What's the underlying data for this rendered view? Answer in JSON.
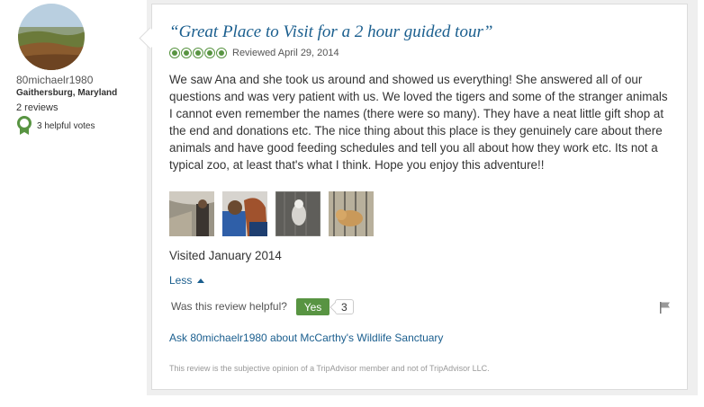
{
  "reviewer": {
    "username": "80michaelr1980",
    "location": "Gaithersburg, Maryland",
    "reviews_count": "2 reviews",
    "helpful_votes": "3 helpful votes"
  },
  "review": {
    "title": "“Great Place to Visit for a 2 hour guided tour”",
    "rating": 5,
    "rating_max": 5,
    "reviewed_date": "Reviewed April 29, 2014",
    "body": "We saw Ana and she took us around and showed us everything! She answered all of our questions and was very patient with us. We loved the tigers and some of the stranger animals I cannot even remember the names (there were so many). They have a neat little gift shop at the end and donations etc. The nice thing about this place is they genuinely care about there animals and have good feeding schedules and tell you all about how they work etc. Its not a typical zoo, at least that's what I think. Hope you enjoy this adventure!!",
    "visited": "Visited January 2014",
    "less_label": "Less",
    "photo_count": 4
  },
  "actions": {
    "helpful_question": "Was this review helpful?",
    "yes_label": "Yes",
    "yes_count": "3",
    "ask_label": "Ask 80michaelr1980 about McCarthy's Wildlife Sanctuary"
  },
  "disclaimer": "This review is the subjective opinion of a TripAdvisor member and not of TripAdvisor LLC.",
  "colors": {
    "link": "#1a5e8e",
    "rating_green": "#589442",
    "button_green": "#589442"
  },
  "icons": {
    "helpful_badge": "ribbon-icon",
    "flag": "flag-icon",
    "less_caret": "caret-up-icon"
  }
}
